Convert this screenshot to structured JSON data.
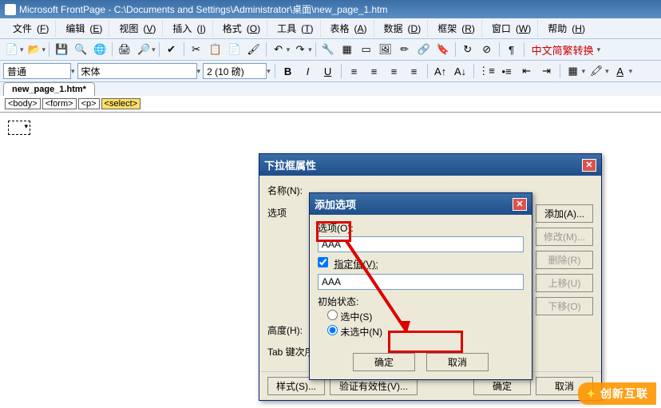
{
  "title_bar": {
    "app": "Microsoft FrontPage",
    "path": "C:\\Documents and Settings\\Administrator\\桌面\\new_page_1.htm"
  },
  "menus": [
    {
      "label": "文件",
      "key": "F"
    },
    {
      "label": "编辑",
      "key": "E"
    },
    {
      "label": "视图",
      "key": "V"
    },
    {
      "label": "插入",
      "key": "I"
    },
    {
      "label": "格式",
      "key": "O"
    },
    {
      "label": "工具",
      "key": "T"
    },
    {
      "label": "表格",
      "key": "A"
    },
    {
      "label": "数据",
      "key": "D"
    },
    {
      "label": "框架",
      "key": "R"
    },
    {
      "label": "窗口",
      "key": "W"
    },
    {
      "label": "帮助",
      "key": "H"
    }
  ],
  "toolbar": {
    "lang_toggle": "中文简繁转换"
  },
  "format": {
    "style": "普通",
    "font": "宋体",
    "size": "2 (10 磅)",
    "bold": "B",
    "italic": "I",
    "underline": "U"
  },
  "tab": "new_page_1.htm*",
  "breadcrumb": [
    "<body>",
    "<form>",
    "<p>",
    "<select>"
  ],
  "dropdown_dialog": {
    "title": "下拉框属性",
    "name_label": "名称(N):",
    "option_label": "选项",
    "height_label": "高度(H):",
    "tab_label": "Tab 键次序",
    "buttons": {
      "add": "添加(A)...",
      "modify": "修改(M)...",
      "remove": "删除(R)",
      "up": "上移(U)",
      "down": "下移(O)",
      "style": "样式(S)...",
      "validate": "验证有效性(V)...",
      "ok": "确定",
      "cancel": "取消"
    }
  },
  "add_option_dialog": {
    "title": "添加选项",
    "option_label": "选项(O):",
    "option_value": "AAA",
    "specify_value_label": "指定值(V):",
    "specify_value_checked": true,
    "value_text": "AAA",
    "initial_state_label": "初始状态:",
    "radio_selected": "选中(S)",
    "radio_unselected": "未选中(N)",
    "radio_value": "unselected",
    "ok": "确定",
    "cancel": "取消"
  },
  "watermark": "创新互联"
}
